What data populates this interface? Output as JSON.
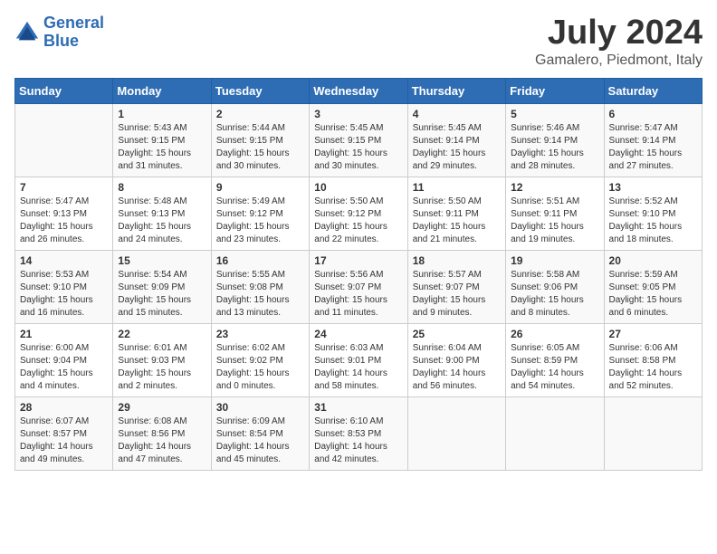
{
  "logo": {
    "line1": "General",
    "line2": "Blue"
  },
  "header": {
    "month": "July 2024",
    "location": "Gamalero, Piedmont, Italy"
  },
  "weekdays": [
    "Sunday",
    "Monday",
    "Tuesday",
    "Wednesday",
    "Thursday",
    "Friday",
    "Saturday"
  ],
  "weeks": [
    [
      {
        "day": "",
        "info": ""
      },
      {
        "day": "1",
        "info": "Sunrise: 5:43 AM\nSunset: 9:15 PM\nDaylight: 15 hours\nand 31 minutes."
      },
      {
        "day": "2",
        "info": "Sunrise: 5:44 AM\nSunset: 9:15 PM\nDaylight: 15 hours\nand 30 minutes."
      },
      {
        "day": "3",
        "info": "Sunrise: 5:45 AM\nSunset: 9:15 PM\nDaylight: 15 hours\nand 30 minutes."
      },
      {
        "day": "4",
        "info": "Sunrise: 5:45 AM\nSunset: 9:14 PM\nDaylight: 15 hours\nand 29 minutes."
      },
      {
        "day": "5",
        "info": "Sunrise: 5:46 AM\nSunset: 9:14 PM\nDaylight: 15 hours\nand 28 minutes."
      },
      {
        "day": "6",
        "info": "Sunrise: 5:47 AM\nSunset: 9:14 PM\nDaylight: 15 hours\nand 27 minutes."
      }
    ],
    [
      {
        "day": "7",
        "info": "Sunrise: 5:47 AM\nSunset: 9:13 PM\nDaylight: 15 hours\nand 26 minutes."
      },
      {
        "day": "8",
        "info": "Sunrise: 5:48 AM\nSunset: 9:13 PM\nDaylight: 15 hours\nand 24 minutes."
      },
      {
        "day": "9",
        "info": "Sunrise: 5:49 AM\nSunset: 9:12 PM\nDaylight: 15 hours\nand 23 minutes."
      },
      {
        "day": "10",
        "info": "Sunrise: 5:50 AM\nSunset: 9:12 PM\nDaylight: 15 hours\nand 22 minutes."
      },
      {
        "day": "11",
        "info": "Sunrise: 5:50 AM\nSunset: 9:11 PM\nDaylight: 15 hours\nand 21 minutes."
      },
      {
        "day": "12",
        "info": "Sunrise: 5:51 AM\nSunset: 9:11 PM\nDaylight: 15 hours\nand 19 minutes."
      },
      {
        "day": "13",
        "info": "Sunrise: 5:52 AM\nSunset: 9:10 PM\nDaylight: 15 hours\nand 18 minutes."
      }
    ],
    [
      {
        "day": "14",
        "info": "Sunrise: 5:53 AM\nSunset: 9:10 PM\nDaylight: 15 hours\nand 16 minutes."
      },
      {
        "day": "15",
        "info": "Sunrise: 5:54 AM\nSunset: 9:09 PM\nDaylight: 15 hours\nand 15 minutes."
      },
      {
        "day": "16",
        "info": "Sunrise: 5:55 AM\nSunset: 9:08 PM\nDaylight: 15 hours\nand 13 minutes."
      },
      {
        "day": "17",
        "info": "Sunrise: 5:56 AM\nSunset: 9:07 PM\nDaylight: 15 hours\nand 11 minutes."
      },
      {
        "day": "18",
        "info": "Sunrise: 5:57 AM\nSunset: 9:07 PM\nDaylight: 15 hours\nand 9 minutes."
      },
      {
        "day": "19",
        "info": "Sunrise: 5:58 AM\nSunset: 9:06 PM\nDaylight: 15 hours\nand 8 minutes."
      },
      {
        "day": "20",
        "info": "Sunrise: 5:59 AM\nSunset: 9:05 PM\nDaylight: 15 hours\nand 6 minutes."
      }
    ],
    [
      {
        "day": "21",
        "info": "Sunrise: 6:00 AM\nSunset: 9:04 PM\nDaylight: 15 hours\nand 4 minutes."
      },
      {
        "day": "22",
        "info": "Sunrise: 6:01 AM\nSunset: 9:03 PM\nDaylight: 15 hours\nand 2 minutes."
      },
      {
        "day": "23",
        "info": "Sunrise: 6:02 AM\nSunset: 9:02 PM\nDaylight: 15 hours\nand 0 minutes."
      },
      {
        "day": "24",
        "info": "Sunrise: 6:03 AM\nSunset: 9:01 PM\nDaylight: 14 hours\nand 58 minutes."
      },
      {
        "day": "25",
        "info": "Sunrise: 6:04 AM\nSunset: 9:00 PM\nDaylight: 14 hours\nand 56 minutes."
      },
      {
        "day": "26",
        "info": "Sunrise: 6:05 AM\nSunset: 8:59 PM\nDaylight: 14 hours\nand 54 minutes."
      },
      {
        "day": "27",
        "info": "Sunrise: 6:06 AM\nSunset: 8:58 PM\nDaylight: 14 hours\nand 52 minutes."
      }
    ],
    [
      {
        "day": "28",
        "info": "Sunrise: 6:07 AM\nSunset: 8:57 PM\nDaylight: 14 hours\nand 49 minutes."
      },
      {
        "day": "29",
        "info": "Sunrise: 6:08 AM\nSunset: 8:56 PM\nDaylight: 14 hours\nand 47 minutes."
      },
      {
        "day": "30",
        "info": "Sunrise: 6:09 AM\nSunset: 8:54 PM\nDaylight: 14 hours\nand 45 minutes."
      },
      {
        "day": "31",
        "info": "Sunrise: 6:10 AM\nSunset: 8:53 PM\nDaylight: 14 hours\nand 42 minutes."
      },
      {
        "day": "",
        "info": ""
      },
      {
        "day": "",
        "info": ""
      },
      {
        "day": "",
        "info": ""
      }
    ]
  ]
}
